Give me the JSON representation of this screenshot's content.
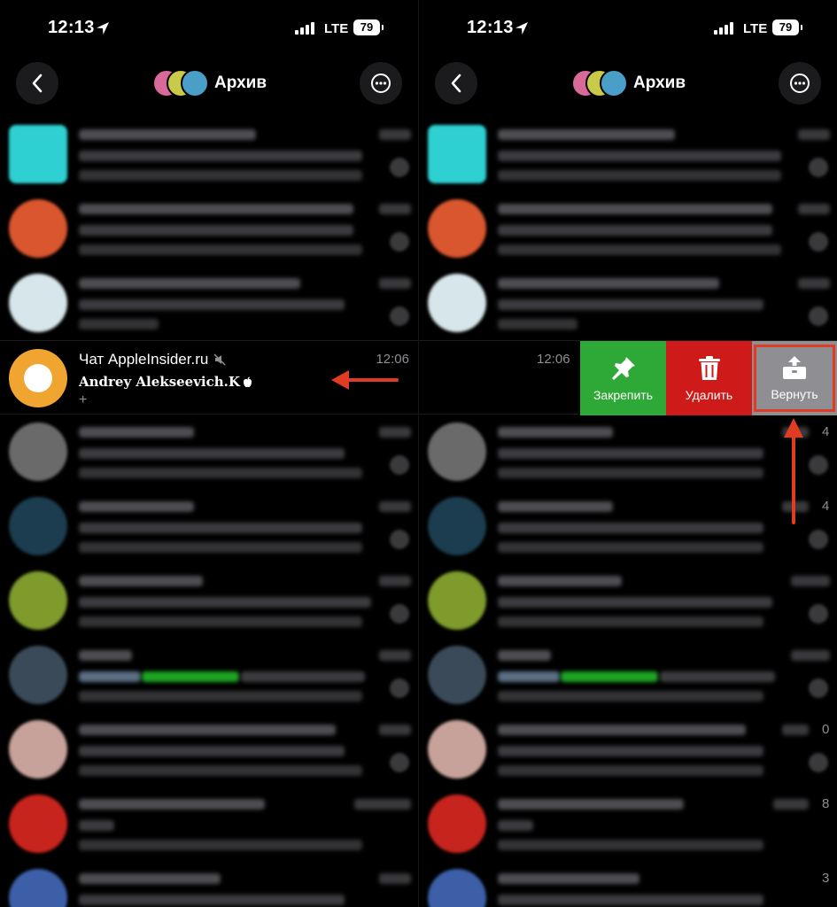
{
  "status_bar": {
    "time": "12:13",
    "network": "LTE",
    "battery": "79"
  },
  "header": {
    "title": "Архив"
  },
  "chat": {
    "title": "Чат AppleInsider.ru",
    "time": "12:06",
    "sender": "Andrey Alekseevich.K",
    "preview": "+"
  },
  "swipe_actions": [
    {
      "id": "pin",
      "label": "Закрепить",
      "icon": "pin-icon",
      "color": "#2ea836"
    },
    {
      "id": "delete",
      "label": "Удалить",
      "icon": "trash-icon",
      "color": "#cf1a1a"
    },
    {
      "id": "return",
      "label": "Вернуть",
      "icon": "unarchive-icon",
      "color": "#8e8e93"
    }
  ],
  "annotation_color": "#e23b24",
  "edge_digits": [
    "4",
    "4",
    "",
    "",
    "0",
    "8",
    "3"
  ]
}
